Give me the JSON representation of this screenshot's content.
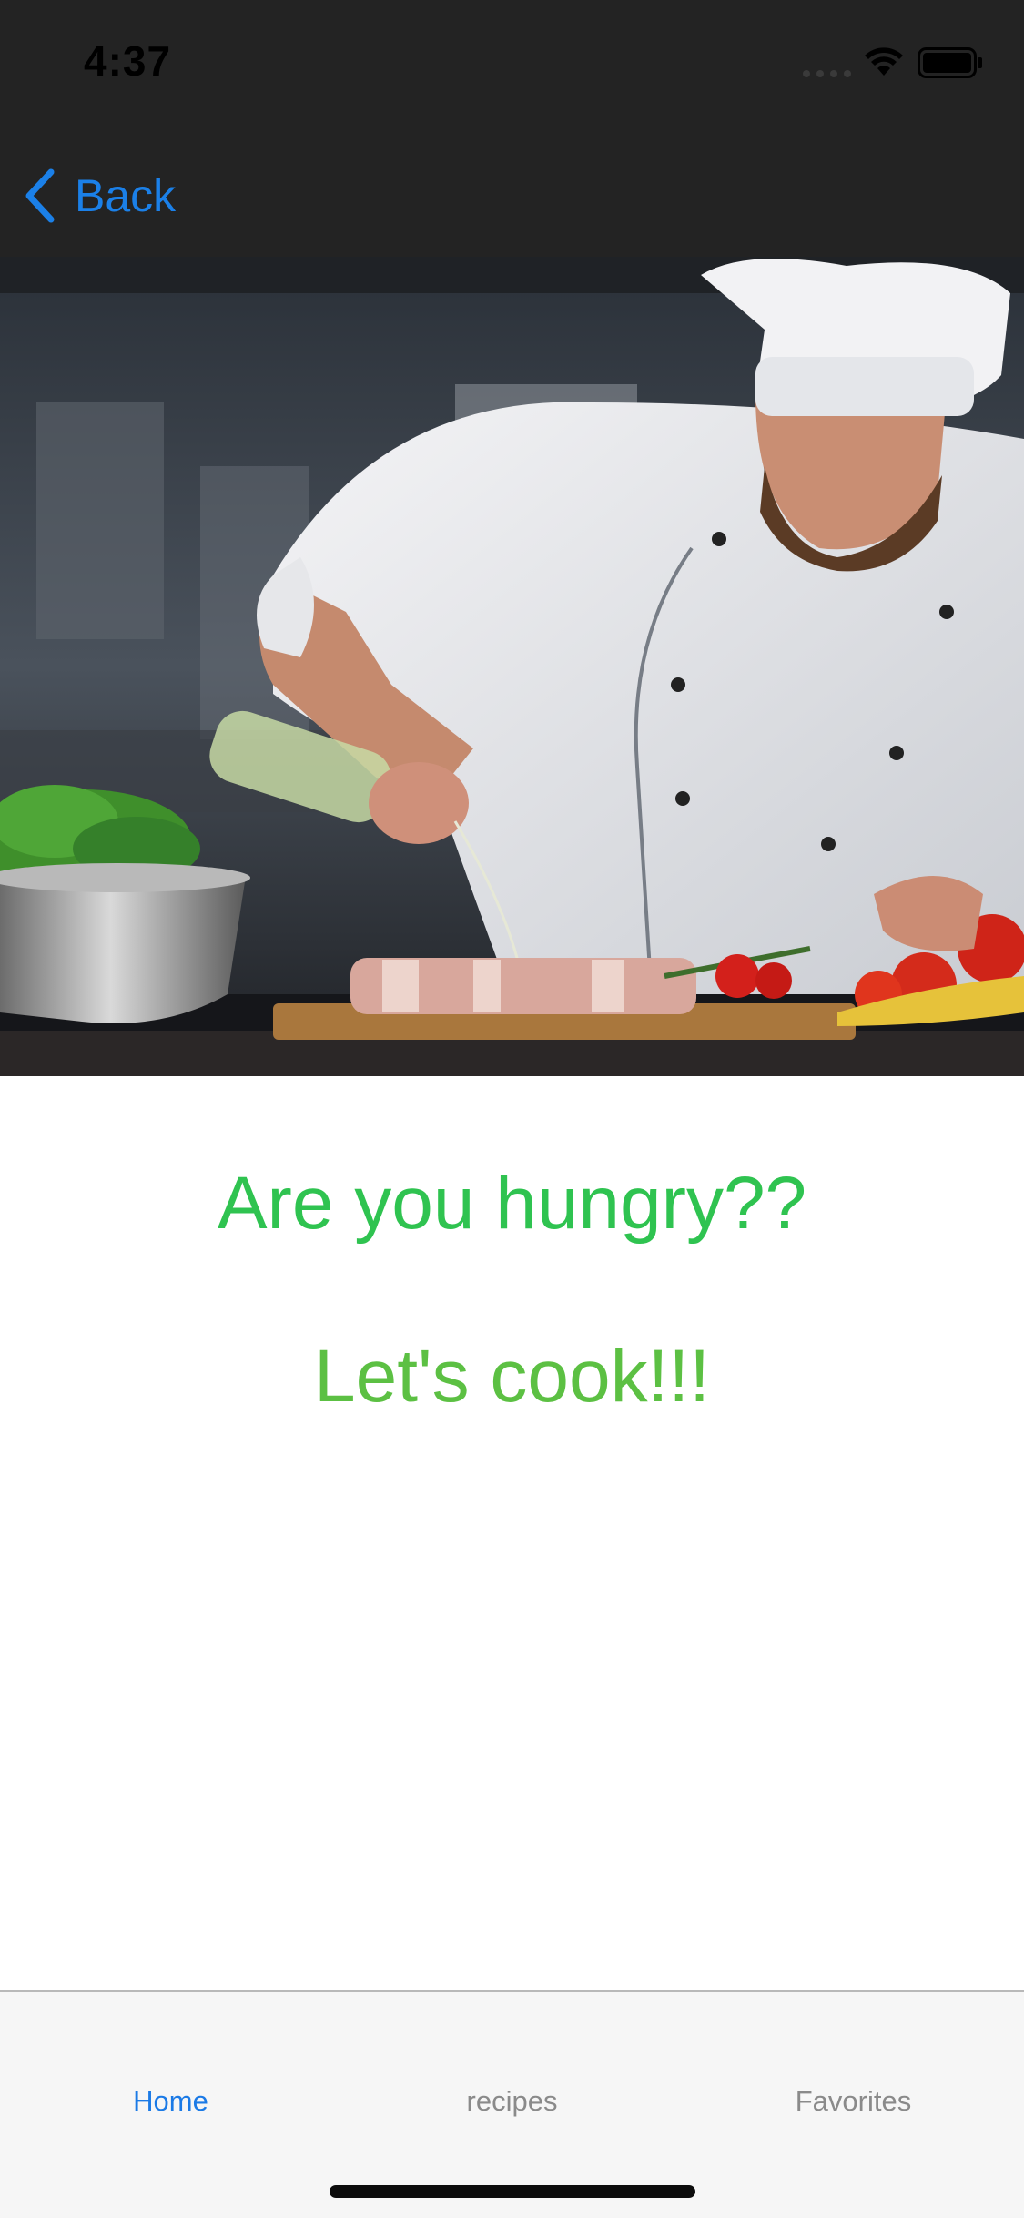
{
  "status_bar": {
    "time": "4:37",
    "icons": [
      "signal-icon",
      "wifi-icon",
      "battery-icon"
    ]
  },
  "nav": {
    "back_label": "Back",
    "back_icon": "chevron-left-icon"
  },
  "hero": {
    "image": "chef-cooking-photo"
  },
  "main": {
    "headline": "Are you hungry??",
    "subheadline": "Let's cook!!!"
  },
  "tabs": [
    {
      "label": "Home",
      "active": true
    },
    {
      "label": "recipes",
      "active": false
    },
    {
      "label": "Favorites",
      "active": false
    }
  ],
  "colors": {
    "bar_background": "#232323",
    "accent_blue": "#1b80e8",
    "headline_green": "#2fc350",
    "subheadline_green": "#5cc043",
    "tab_inactive": "#8a8a8a",
    "tab_bar_background": "#f6f6f6"
  }
}
